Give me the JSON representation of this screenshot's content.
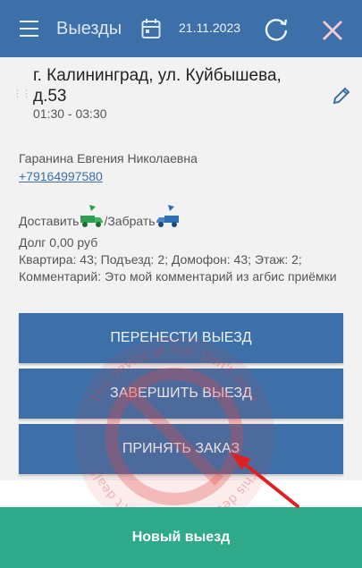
{
  "appbar": {
    "menu_icon": "hamburger-menu-icon",
    "title": "Выезды",
    "calendar_icon": "calendar-icon",
    "date": "21.11.2023",
    "sync_icon": "refresh-icon",
    "close_icon": "close-icon",
    "background": "#3d6fa8"
  },
  "visit": {
    "address": "г. Калининград, ул. Куйбышева, д.53",
    "time": "01:30 - 03:30",
    "contact_name": "Гаранина Евгения Николаевна",
    "phone": "+79164997580",
    "deliver_label": "Доставить",
    "separator": "/",
    "pickup_label": "Забрать",
    "deliver_icon": "green-truck-icon",
    "pickup_icon": "blue-truck-icon",
    "debt": "Долг 0,00 руб",
    "details": "Квартира: 43; Подъезд: 2; Домофон: 43; Этаж: 2;",
    "comment": "Комментарий: Это мой комментарий из агбис приёмки"
  },
  "actions": {
    "reschedule": "ПЕРЕНЕСТИ ВЫЕЗД",
    "finish": "ЗАВЕРШИТЬ ВЫЕЗД",
    "accept": "ПРИНЯТЬ ЗАКАЗ"
  },
  "watermark": {
    "text": "This device at risk. Don't deal!"
  },
  "footer": {
    "new_visit": "Новый выезд",
    "background": "#2ea98a"
  }
}
